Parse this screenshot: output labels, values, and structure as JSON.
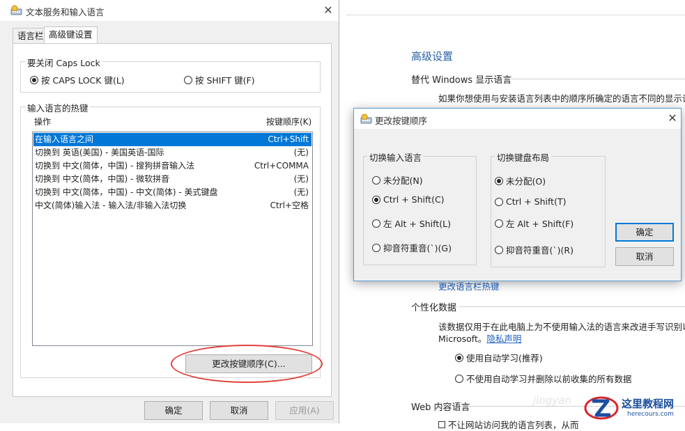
{
  "background_page": {
    "title": "高级设置",
    "section_display_language": "替代 Windows 显示语言",
    "display_language_desc": "如果你想使用与安装语言列表中的顺序所确定的语言不同的显示语",
    "change_hotkeys_link": "更改语言栏热键",
    "section_personalization": "个性化数据",
    "personalization_desc": "该数据仅用于在此电脑上为不使用输入法的语言来改进手写识别以及",
    "personalization_desc2": "Microsoft。",
    "privacy_link": "隐私声明",
    "option_auto_learn": "使用自动学习(推荐)",
    "option_no_auto_learn": "不使用自动学习并删除以前收集的所有数据",
    "section_web_content": "Web 内容语言",
    "web_content_desc": "不让网站访问我的语言列表，从而"
  },
  "main_dialog": {
    "title": "文本服务和输入语言",
    "tabs": [
      {
        "label": "语言栏",
        "active": false
      },
      {
        "label": "高级键设置",
        "active": true
      }
    ],
    "caps_lock_group": {
      "label": "要关闭 Caps Lock",
      "options": [
        {
          "label": "按 CAPS LOCK 键(L)",
          "selected": true
        },
        {
          "label": "按 SHIFT 键(F)",
          "selected": false
        }
      ]
    },
    "hotkeys_group": {
      "label": "输入语言的热键",
      "col_action": "操作",
      "col_key_sequence": "按键顺序(K)",
      "rows": [
        {
          "action": "在输入语言之间",
          "keys": "Ctrl+Shift",
          "selected": true
        },
        {
          "action": "切换到 英语(美国) - 美国英语-国际",
          "keys": "(无)",
          "selected": false
        },
        {
          "action": "切换到 中文(简体，中国) - 搜狗拼音输入法",
          "keys": "Ctrl+COMMA",
          "selected": false
        },
        {
          "action": "切换到 中文(简体，中国) - 微软拼音",
          "keys": "(无)",
          "selected": false
        },
        {
          "action": "切换到 中文(简体，中国) - 中文(简体) - 美式键盘",
          "keys": "(无)",
          "selected": false
        },
        {
          "action": "中文(简体)输入法 - 输入法/非输入法切换",
          "keys": "Ctrl+空格",
          "selected": false
        }
      ],
      "change_sequence_button": "更改按键顺序(C)..."
    },
    "buttons": {
      "ok": "确定",
      "cancel": "取消",
      "apply": "应用(A)"
    }
  },
  "popup_dialog": {
    "title": "更改按键顺序",
    "switch_input_language": {
      "label": "切换输入语言",
      "options": [
        {
          "label": "未分配(N)",
          "selected": false
        },
        {
          "label": "Ctrl + Shift(C)",
          "selected": true
        },
        {
          "label": "左 Alt + Shift(L)",
          "selected": false
        },
        {
          "label": "抑音符重音(`)(G)",
          "selected": false
        }
      ]
    },
    "switch_keyboard_layout": {
      "label": "切换键盘布局",
      "options": [
        {
          "label": "未分配(O)",
          "selected": true
        },
        {
          "label": "Ctrl + Shift(T)",
          "selected": false
        },
        {
          "label": "左 Alt + Shift(F)",
          "selected": false
        },
        {
          "label": "抑音符重音(`)(R)",
          "selected": false
        }
      ]
    },
    "ok": "确定",
    "cancel": "取消"
  },
  "watermark": {
    "site_name": "这里教程网",
    "url": "herecours.com",
    "faint_text": "jingyan"
  },
  "colors": {
    "accent": "#0078d7",
    "highlight_ellipse": "#e0413a",
    "heading_blue": "#2a5fa8"
  }
}
